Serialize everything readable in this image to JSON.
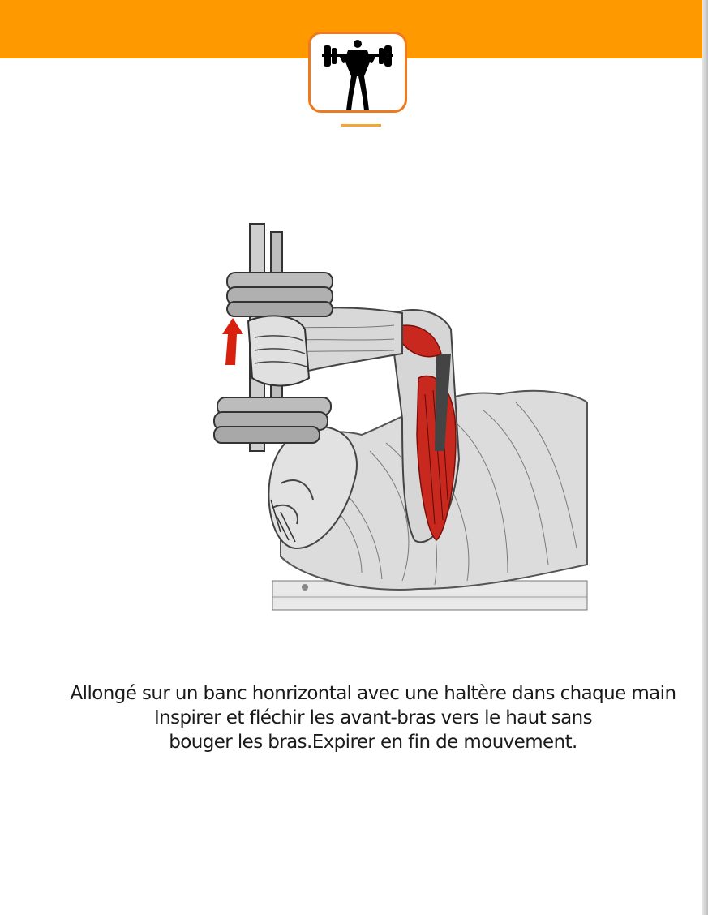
{
  "header": {
    "accent_color": "#ff9900",
    "logo_icon": "weightlifter-icon",
    "logo_border_color": "#ee7a1f"
  },
  "illustration": {
    "subject": "lying-dumbbell-triceps-extension",
    "highlight_color": "#c8281e",
    "arrow_icon": "up-arrow-icon"
  },
  "instructions": {
    "line1": "Allongé sur un banc honrizontal avec une haltère dans chaque main",
    "line2": "Inspirer et fléchir les avant-bras vers le haut sans",
    "line3": "bouger les bras.Expirer en fin de mouvement."
  }
}
